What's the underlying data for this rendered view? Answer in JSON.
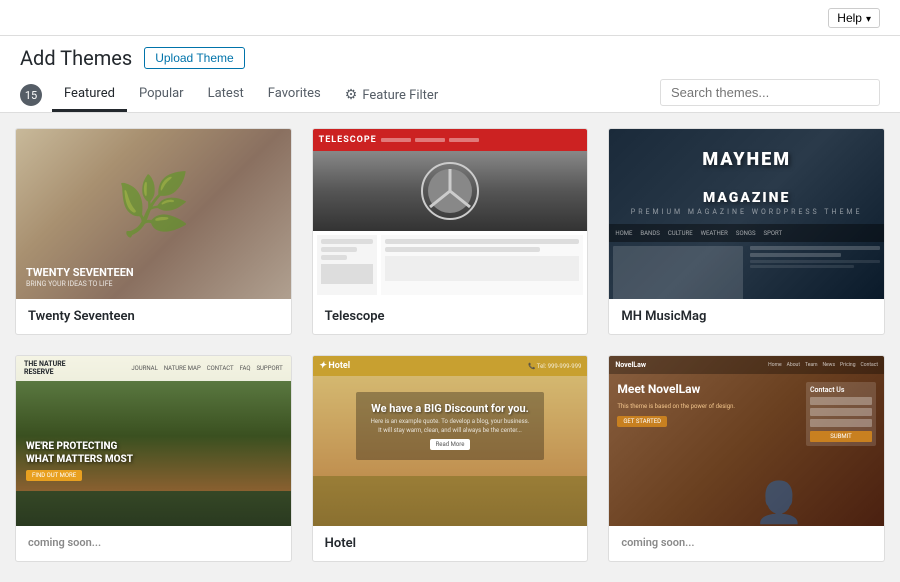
{
  "topbar": {
    "help_label": "Help"
  },
  "page": {
    "title": "Add Themes",
    "upload_button": "Upload Theme"
  },
  "tabs": {
    "count": "15",
    "items": [
      {
        "id": "featured",
        "label": "Featured",
        "active": true
      },
      {
        "id": "popular",
        "label": "Popular",
        "active": false
      },
      {
        "id": "latest",
        "label": "Latest",
        "active": false
      },
      {
        "id": "favorites",
        "label": "Favorites",
        "active": false
      }
    ],
    "feature_filter": "Feature Filter"
  },
  "search": {
    "placeholder": "Search themes..."
  },
  "themes": [
    {
      "id": "twenty-seventeen",
      "name": "Twenty Seventeen",
      "thumb_text_line1": "TWENTY SEVENTEEN",
      "thumb_text_line2": "Bring your ideas to life"
    },
    {
      "id": "telescope",
      "name": "Telescope"
    },
    {
      "id": "mh-musicmag",
      "name": "MH MusicMag",
      "title_line1": "MAYHEM",
      "title_line2": "MAGAZINE",
      "subtitle": "PREMIUM MAGAZINE WORDPRESS THEME"
    },
    {
      "id": "nature-reserve",
      "name": "The Nature Reserve",
      "logo_line1": "THE NATURE",
      "logo_line2": "RESERVE",
      "protecting_text": "WE'RE PROTECTING\nWHAT MATTERS MOST",
      "cta": "FIND OUT MORE"
    },
    {
      "id": "hotel",
      "name": "Hotel",
      "logo": "Hotel",
      "heading": "We have a BIG Discount for you.",
      "subtext": "Here is an example quote. To develop a blog, your business. It will stay warm, clean, and will always be the center of attention that's all. Mind start with some words that matter to you in order to present at the audience.",
      "read_more": "Read More"
    },
    {
      "id": "novellaw",
      "name": "NovelLaw",
      "title": "Meet NovelLaw",
      "desc": "This theme is based on the power of design.",
      "cta": "GET STARTED",
      "contact_label": "Contact Us",
      "submit_label": "SUBMIT"
    }
  ]
}
